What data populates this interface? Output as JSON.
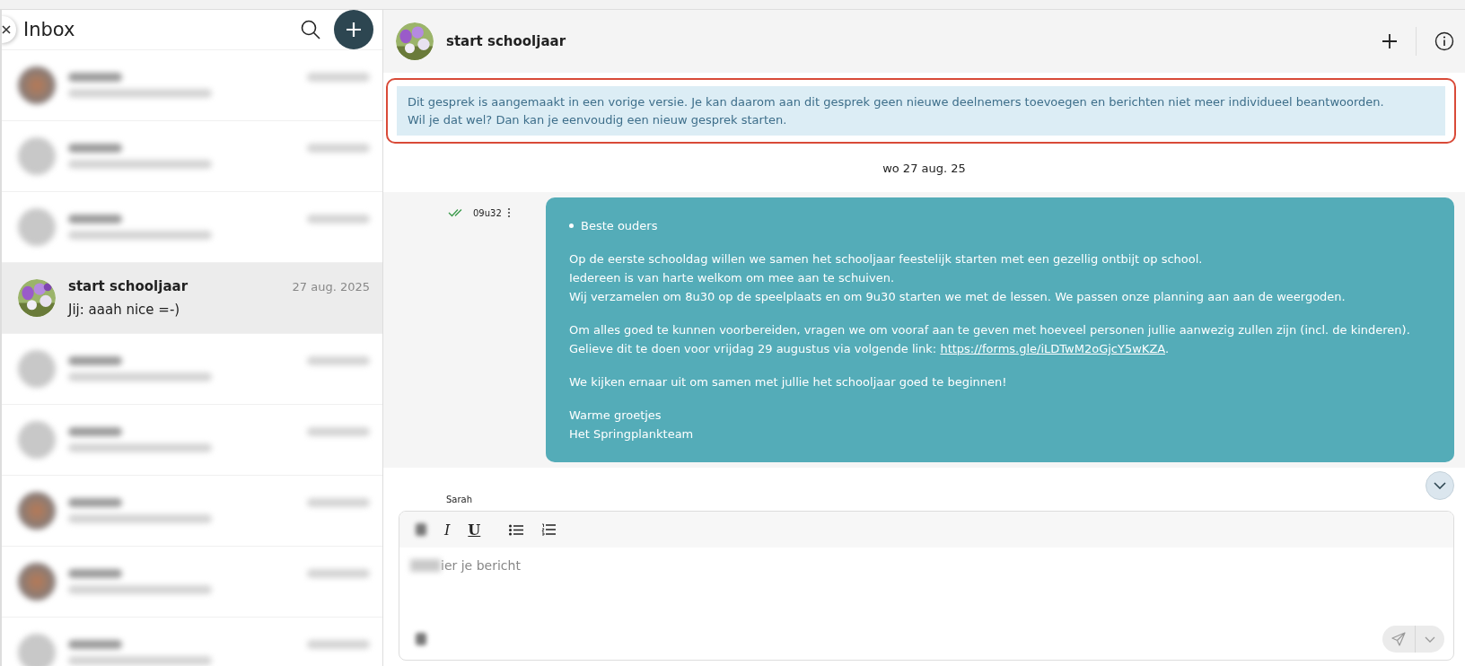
{
  "sidebar": {
    "title": "Inbox",
    "conversations": [
      {
        "kind": "blurred",
        "selected": false
      },
      {
        "kind": "blurred",
        "avatar": {
          "kind": "plain"
        },
        "selected": false
      },
      {
        "kind": "blurred",
        "avatar": {
          "kind": "plain"
        },
        "selected": false
      },
      {
        "kind": "visible",
        "title": "start schooljaar",
        "date": "27 aug. 2025",
        "preview": "Jij: aaah nice =-)",
        "selected": true
      },
      {
        "kind": "blurred",
        "avatar": {
          "kind": "plain"
        },
        "selected": false
      },
      {
        "kind": "blurred",
        "avatar": {
          "kind": "plain"
        },
        "selected": false
      },
      {
        "kind": "blurred",
        "selected": false
      },
      {
        "kind": "blurred",
        "selected": false
      },
      {
        "kind": "blurred",
        "avatar": {
          "kind": "plain"
        },
        "selected": false
      }
    ]
  },
  "chat": {
    "title": "start schooljaar",
    "notice": [
      "Dit gesprek is aangemaakt in een vorige versie. Je kan daarom aan dit gesprek geen nieuwe deelnemers toevoegen en berichten niet meer individueel beantwoorden.",
      "Wil je dat wel? Dan kan je eenvoudig een nieuw gesprek starten."
    ],
    "date_separator": "wo 27 aug. 25",
    "message": {
      "time": "09u32",
      "read": true,
      "bullet": "Beste ouders",
      "paragraphs": [
        [
          "Op de eerste schooldag willen we samen het schooljaar feestelijk starten met een gezellig ontbijt op school.",
          "Iedereen is van harte welkom om mee aan te schuiven.",
          "Wij verzamelen om 8u30 op de speelplaats en om 9u30 starten we met de lessen. We passen onze planning aan aan de weergoden."
        ],
        [
          "Om alles goed te kunnen voorbereiden, vragen we om vooraf aan te geven met hoeveel personen jullie aanwezig zullen zijn (incl. de kinderen).",
          {
            "before": "Gelieve dit te doen voor vrijdag 29 augustus via volgende link: ",
            "link": "https://forms.gle/iLDTwM2oGjcY5wKZA",
            "after": "."
          }
        ],
        [
          "We kijken ernaar uit om samen met jullie het schooljaar goed te beginnen!"
        ],
        [
          "Warme groetjes",
          "Het Springplankteam"
        ]
      ]
    },
    "composer": {
      "sender": "Sarah",
      "format_buttons": [
        {
          "kind": "blurred"
        },
        {
          "kind": "italic",
          "label": "I"
        },
        {
          "kind": "underline",
          "label": "U"
        },
        {
          "kind": "bullets"
        },
        {
          "kind": "numbers"
        }
      ],
      "placeholder": "ier je bericht"
    }
  }
}
